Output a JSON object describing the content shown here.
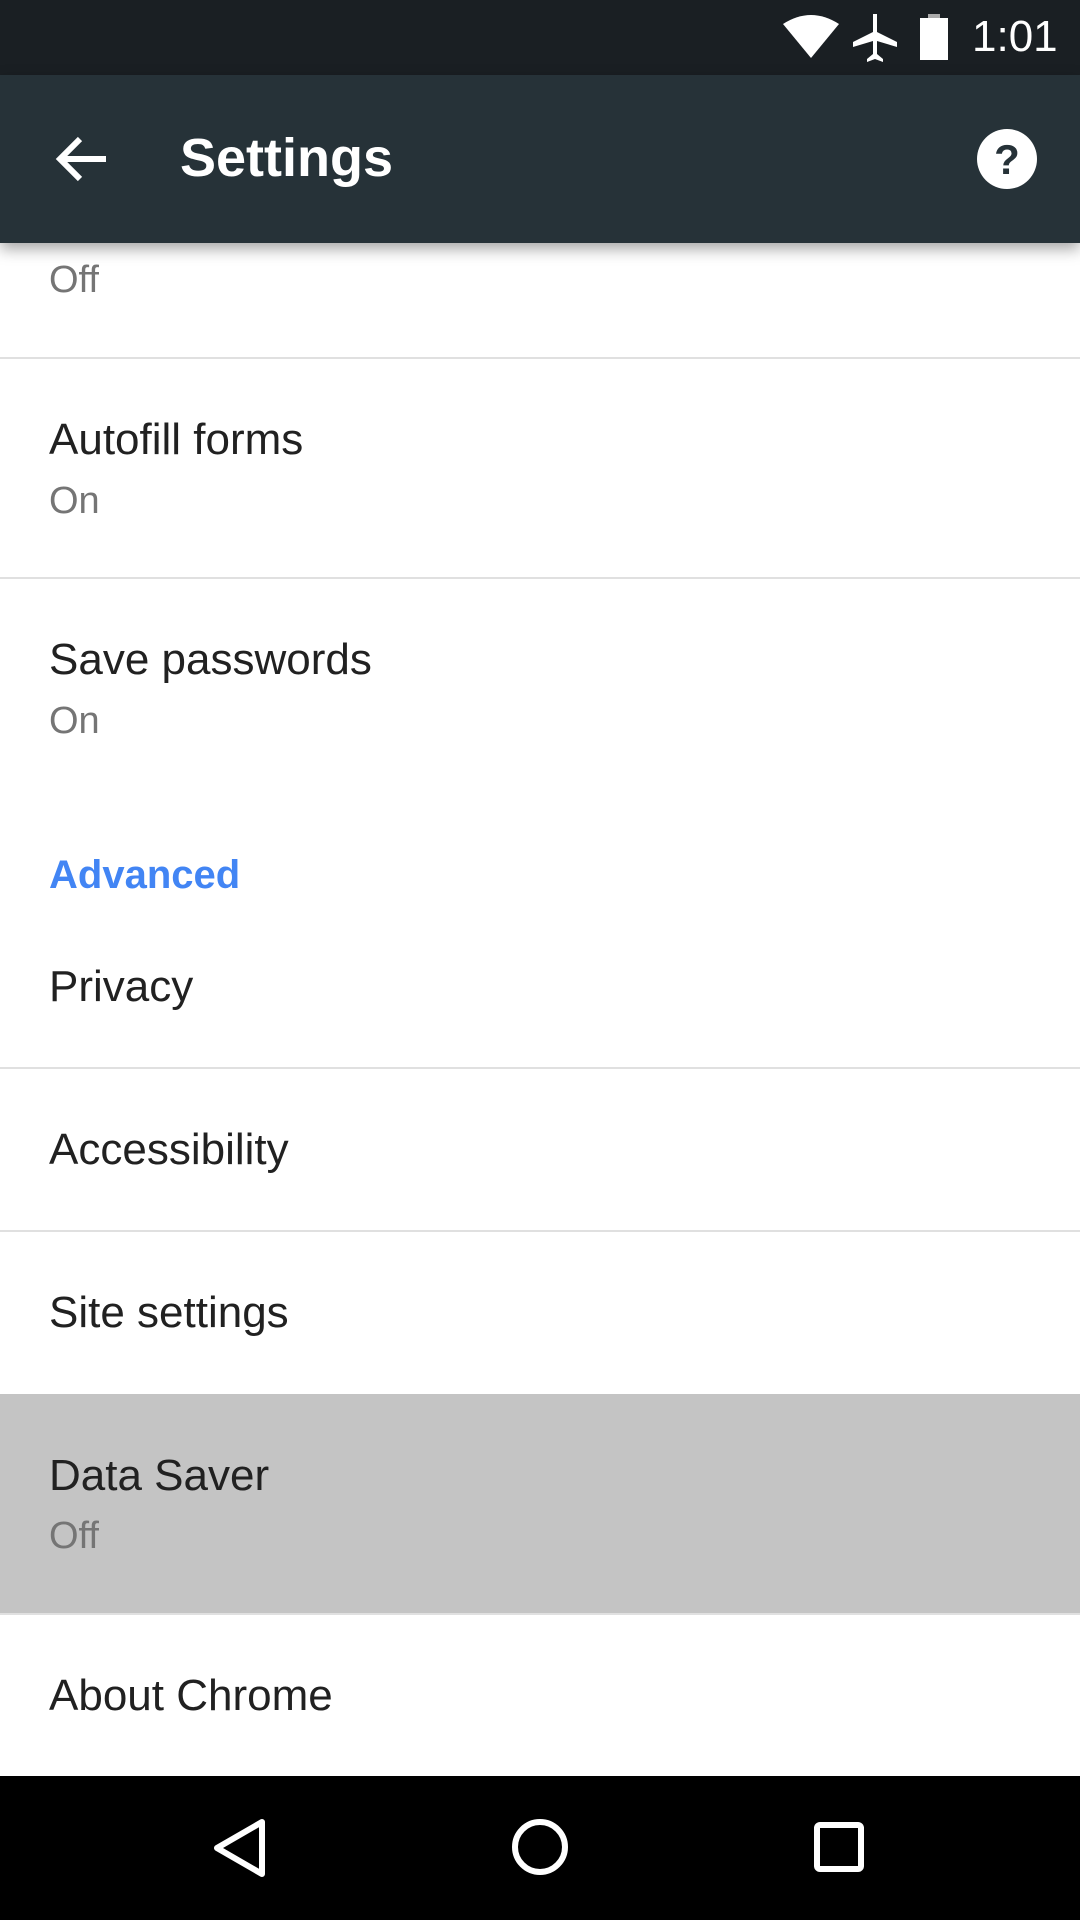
{
  "status_bar": {
    "time": "1:01",
    "icons": [
      "wifi-icon",
      "airplane-icon",
      "battery-icon"
    ]
  },
  "toolbar": {
    "title": "Settings",
    "back_icon": "arrow-left-icon",
    "help_icon": "help-circle-icon"
  },
  "items": [
    {
      "subtitle": "Off"
    },
    {
      "title": "Autofill forms",
      "subtitle": "On"
    },
    {
      "title": "Save passwords",
      "subtitle": "On"
    }
  ],
  "advanced": {
    "header": "Advanced",
    "items": [
      {
        "title": "Privacy"
      },
      {
        "title": "Accessibility"
      },
      {
        "title": "Site settings"
      },
      {
        "title": "Data Saver",
        "subtitle": "Off",
        "highlighted": true
      },
      {
        "title": "About Chrome"
      }
    ]
  },
  "colors": {
    "accent": "#4285f4",
    "toolbar": "#263238",
    "highlight": "#c4c4c4"
  },
  "nav_bar": {
    "icons": [
      "back-triangle-icon",
      "home-circle-icon",
      "recents-square-icon"
    ]
  }
}
